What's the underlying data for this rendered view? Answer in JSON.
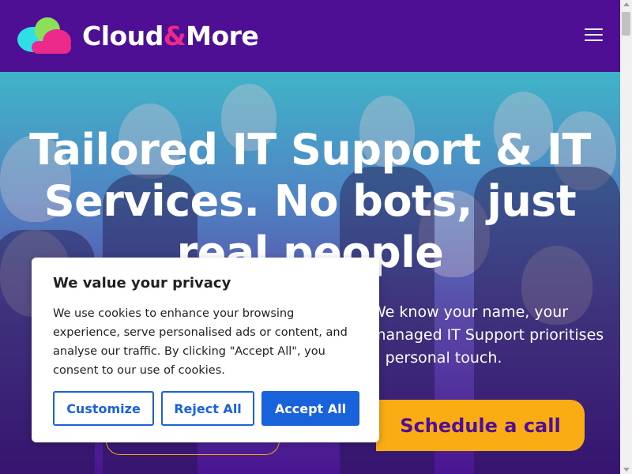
{
  "header": {
    "logo_text_part1": "Cloud",
    "logo_text_amp": "&",
    "logo_text_part2": "More",
    "menu_icon": "hamburger-icon"
  },
  "hero": {
    "title": "Tailored IT Support & IT Services. No bots, just real people",
    "subtitle": "We know your name, your managed IT Support prioritises a personal touch.",
    "cta_label": "Schedule a call"
  },
  "cookie_banner": {
    "title": "We value your privacy",
    "body": "We use cookies to enhance your browsing experience, serve personalised ads or content, and analyse our traffic. By clicking \"Accept All\", you consent to our use of cookies.",
    "customize_label": "Customize",
    "reject_label": "Reject All",
    "accept_label": "Accept All"
  },
  "colors": {
    "header_bg": "#4e0f95",
    "accent_pink": "#ec2a8c",
    "cta_yellow": "#f9ac14",
    "cookie_blue": "#1863dc"
  }
}
